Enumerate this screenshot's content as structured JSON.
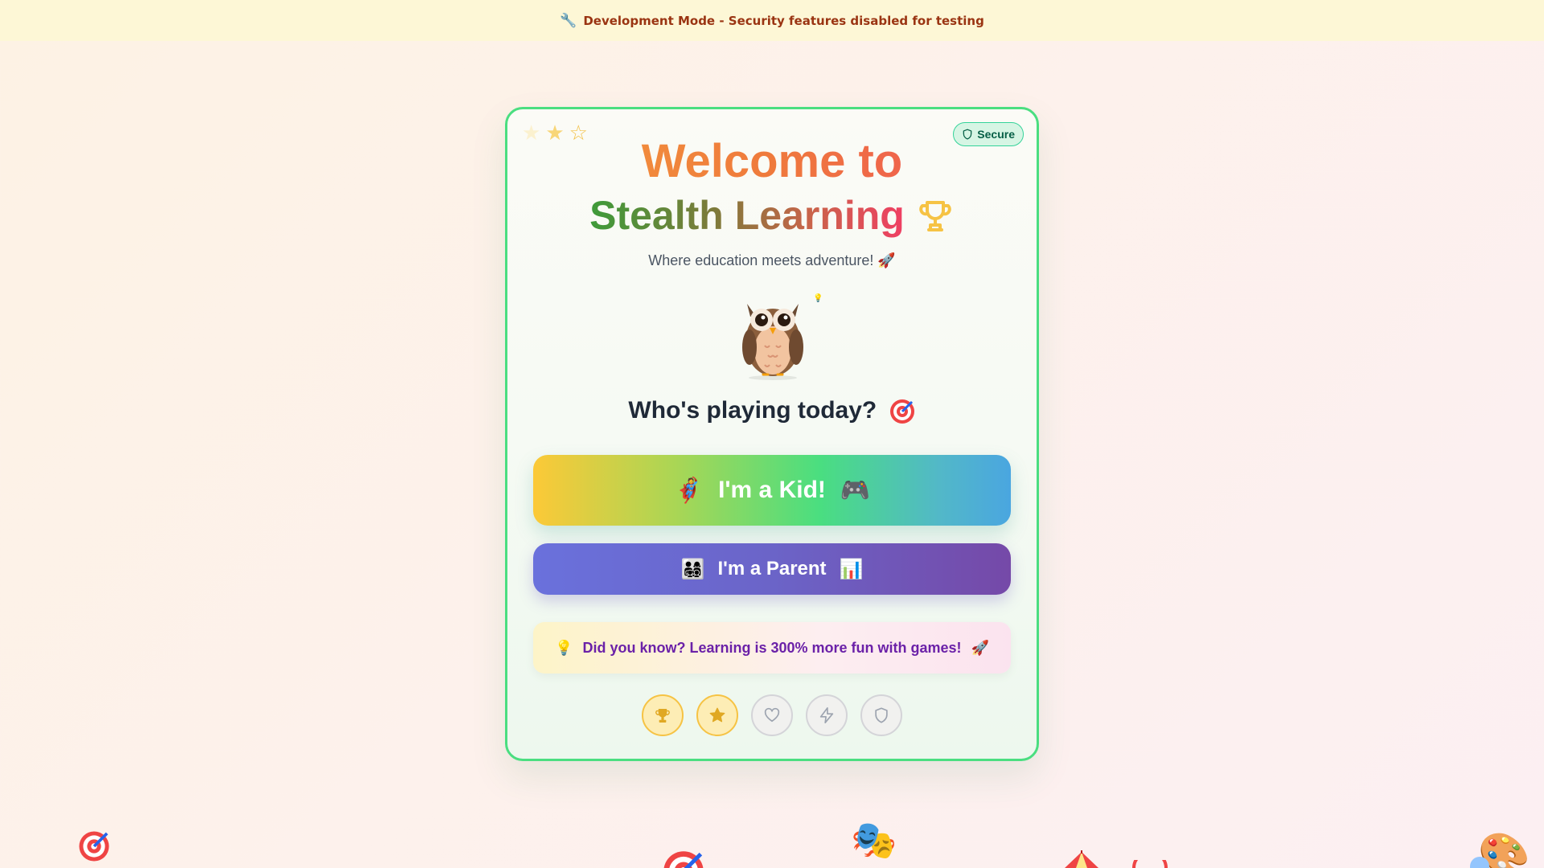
{
  "banner": {
    "icon": "wrench-icon",
    "text": "Development Mode - Security features disabled for testing"
  },
  "card": {
    "stars_icons": [
      "star-icon",
      "star-icon",
      "star-outline-icon"
    ],
    "secure_badge": "Secure",
    "title_line1": "Welcome to",
    "title_line2": "Stealth Learning",
    "tagline": "Where education meets adventure! 🚀",
    "mascot": "owl-icon",
    "question": "Who's playing today?",
    "kid_button": {
      "left_emoji": "🦸",
      "label": "I'm a Kid!",
      "right_emoji": "🎮"
    },
    "parent_button": {
      "left_emoji": "👨‍👩‍👧‍👦",
      "label": "I'm a Parent",
      "right_emoji": "📊"
    },
    "tip": {
      "left_emoji": "💡",
      "text": "Did you know? Learning is 300% more fun with games!",
      "right_emoji": "🚀"
    },
    "achievements": [
      {
        "icon": "trophy-icon",
        "earned": true
      },
      {
        "icon": "star-icon",
        "earned": true
      },
      {
        "icon": "heart-icon",
        "earned": false
      },
      {
        "icon": "lightning-icon",
        "earned": false
      },
      {
        "icon": "shield-icon",
        "earned": false
      }
    ]
  },
  "decor": [
    "target-icon",
    "target-icon",
    "theater-masks-icon",
    "circus-tent-icon",
    "target-icon",
    "palette-icon"
  ],
  "colors": {
    "card_border": "#4ade80",
    "banner_bg": "#fdf7d6",
    "banner_text": "#9a3412",
    "parent_button": "#6b64c8",
    "tip_text": "#6b21a8"
  }
}
